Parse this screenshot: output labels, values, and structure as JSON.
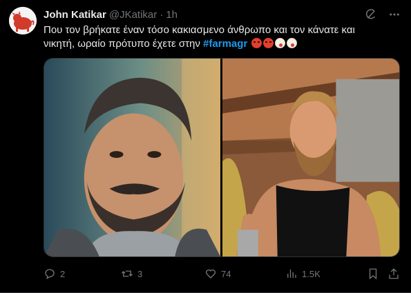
{
  "tweet": {
    "author_name": "John Katikar",
    "author_handle": "@JKatikar",
    "separator": "·",
    "time": "1h",
    "text_line1": "Που τον βρήκατε έναν τόσο κακιασμενο άνθρωπο και τον κάνατε και",
    "text_line2_prefix": "νικητή, ωραίο πρότυπο έχετε στην ",
    "hashtag": "#farmagr",
    "emojis": [
      "angry-face",
      "angry-face",
      "clown-face",
      "clown-face"
    ]
  },
  "header_icons": [
    "grok-icon",
    "more-icon"
  ],
  "media": {
    "images": [
      {
        "name": "man-with-beard-turtleneck-photo"
      },
      {
        "name": "bearded-man-in-barn-photo"
      }
    ]
  },
  "actions": {
    "replies": "2",
    "reposts": "3",
    "likes": "74",
    "views": "1.5K"
  },
  "colors": {
    "background": "#000000",
    "text": "#e7e9ea",
    "muted": "#71767b",
    "link": "#1d9bf0"
  }
}
